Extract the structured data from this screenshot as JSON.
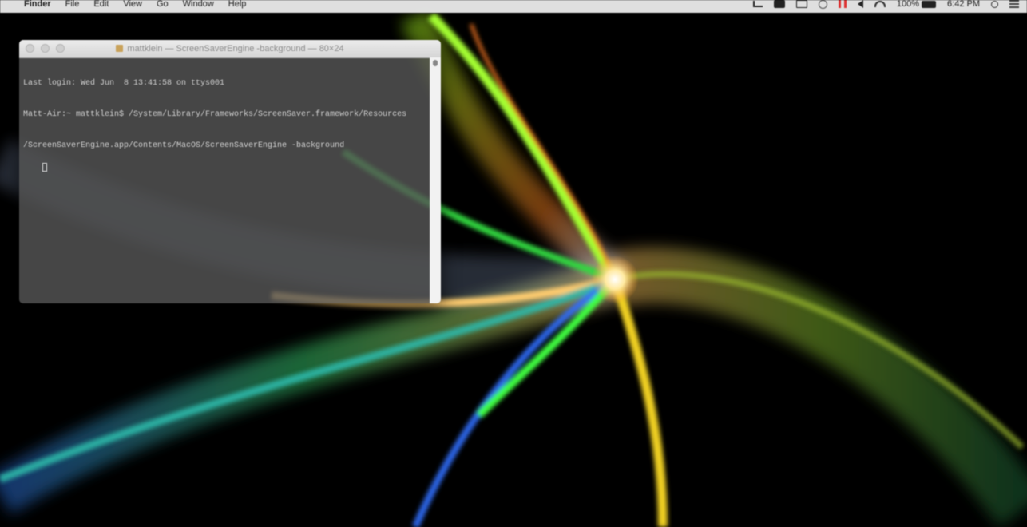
{
  "menubar": {
    "apple_glyph": "",
    "app_name": "Finder",
    "menus": [
      "File",
      "Edit",
      "View",
      "Go",
      "Window",
      "Help"
    ],
    "battery": "100%",
    "clock": "6:42 PM",
    "status_icons": [
      "cast-icon",
      "display-icon",
      "dropbox-icon",
      "time-machine-icon",
      "pause-icon",
      "volume-icon",
      "wifi-icon",
      "battery-icon",
      "spotlight-icon",
      "notification-center-icon"
    ]
  },
  "terminal": {
    "title": "mattklein — ScreenSaverEngine -background — 80×24",
    "lines": [
      "Last login: Wed Jun  8 13:41:58 on ttys001",
      "Matt-Air:~ mattklein$ /System/Library/Frameworks/ScreenSaver.framework/Resources",
      "/ScreenSaverEngine.app/Contents/MacOS/ScreenSaverEngine -background"
    ]
  }
}
